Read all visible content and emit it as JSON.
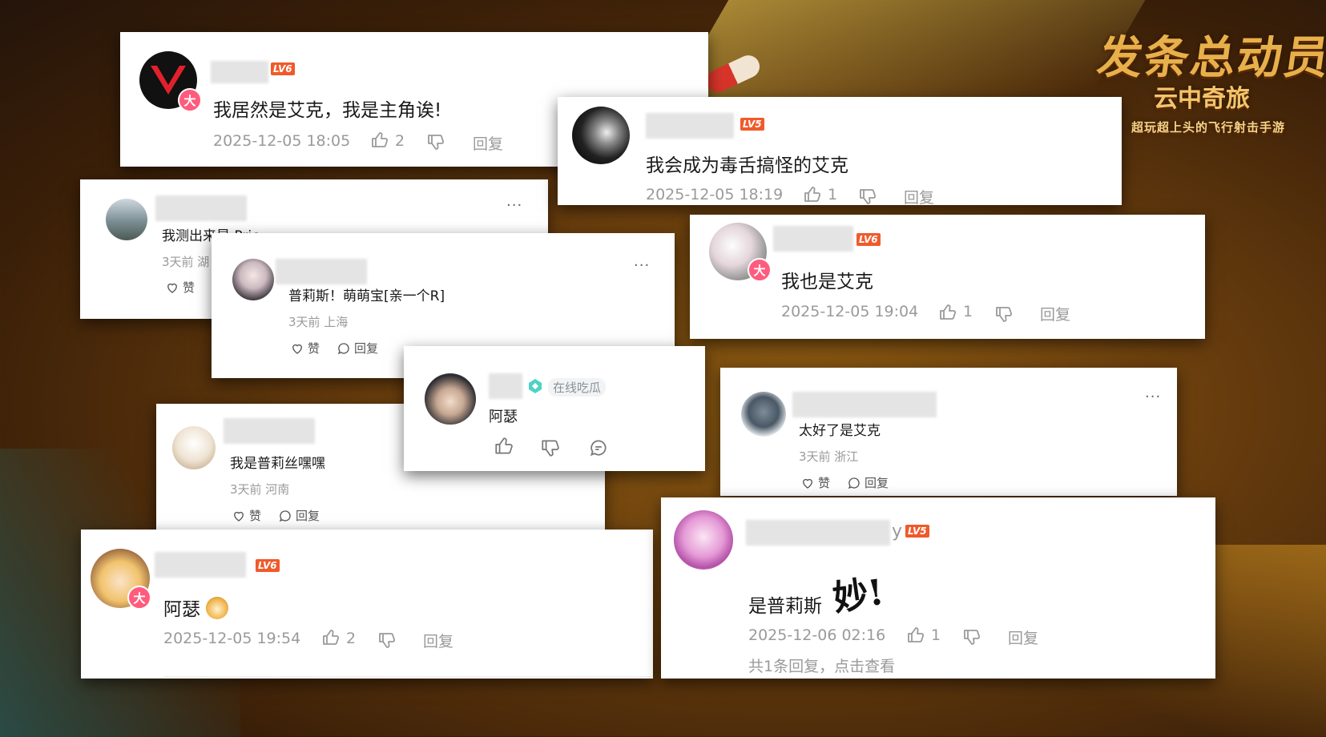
{
  "logo": {
    "line1": "发条总动员",
    "line2": "云中奇旅",
    "line3": "超玩超上头的飞行射击手游"
  },
  "c1": {
    "level": "LV6",
    "badge": "大",
    "text": "我居然是艾克，我是主角诶!",
    "time": "2025-12-05 18:05",
    "likes": "2",
    "reply": "回复"
  },
  "c2": {
    "level": "LV5",
    "text": "我会成为毒舌搞怪的艾克",
    "time": "2025-12-05 18:19",
    "likes": "1",
    "reply": "回复"
  },
  "c3": {
    "text": "我测出来是 Pric",
    "meta": "3天前 湖",
    "like": "赞"
  },
  "c4": {
    "text": "普莉斯！萌萌宝[亲一个R]",
    "meta": "3天前 上海",
    "like": "赞",
    "reply": "回复"
  },
  "c5": {
    "level": "LV6",
    "badge": "大",
    "text": "我也是艾克",
    "time": "2025-12-05 19:04",
    "likes": "1",
    "reply": "回复"
  },
  "c6": {
    "tag": "在线吃瓜",
    "text": "阿瑟"
  },
  "c7": {
    "text": "太好了是艾克",
    "meta": "3天前 浙江",
    "like": "赞",
    "reply": "回复"
  },
  "c8": {
    "text": "我是普莉丝嘿嘿",
    "meta": "3天前 河南",
    "like": "赞",
    "reply": "回复"
  },
  "c9": {
    "level": "LV6",
    "badge": "大",
    "text": "阿瑟",
    "time": "2025-12-05 19:54",
    "likes": "2",
    "reply": "回复"
  },
  "c10": {
    "level": "LV5",
    "name_tail": "y",
    "text": "是普莉斯",
    "sticker": "妙!",
    "time": "2025-12-06 02:16",
    "likes": "1",
    "reply": "回复",
    "thread": "共1条回复，点击查看"
  },
  "colors": {
    "level_badge": "#f05a2a",
    "big_badge": "#ff5b7e",
    "meta_gray": "#9a9a9a"
  }
}
